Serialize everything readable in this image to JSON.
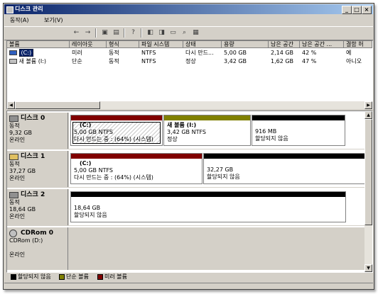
{
  "window": {
    "title": "디스크 관리",
    "controls": {
      "minimize": "_",
      "restore": "□",
      "close": "×"
    }
  },
  "menu": [
    {
      "label": "동작(A)"
    },
    {
      "label": "보기(V)"
    }
  ],
  "toolbar": {
    "icons": [
      "back-icon",
      "forward-icon",
      "up-folder-icon",
      "properties-icon",
      "help-icon",
      "disk-action-icon-1",
      "disk-action-icon-2",
      "folder-open-icon",
      "search-icon",
      "settings-icon"
    ]
  },
  "volume_list": {
    "columns": [
      "볼륨",
      "레이아웃",
      "형식",
      "파일 시스템",
      "상태",
      "용량",
      "남은 공간",
      "남은 공간 ...",
      "결함 허"
    ],
    "rows": [
      {
        "volume": "(C:)",
        "layout": "미러",
        "type": "동적",
        "fs": "NTFS",
        "status": "다시 만드...",
        "capacity": "5,00 GB",
        "free": "2,14 GB",
        "free_pct": "42 %",
        "fault": "예"
      },
      {
        "volume": "새 볼륨 (I:)",
        "layout": "단순",
        "type": "동적",
        "fs": "NTFS",
        "status": "정상",
        "capacity": "3,42 GB",
        "free": "1,62 GB",
        "free_pct": "47 %",
        "fault": "아니오"
      }
    ]
  },
  "disks": [
    {
      "name": "디스크 0",
      "type": "동적",
      "size": "9,32 GB",
      "status": "온라인",
      "partitions": [
        {
          "name": "(C:)",
          "line1": "5,00 GB NTFS",
          "line2": "다시 만드는 중 : (64%) (시스템)",
          "kind": "mirror"
        },
        {
          "name": "새 볼륨  (I:)",
          "line1": "3,42 GB NTFS",
          "line2": "정상",
          "kind": "simple"
        },
        {
          "name": "",
          "line1": "916 MB",
          "line2": "할당되지 않음",
          "kind": "unallocated"
        }
      ]
    },
    {
      "name": "디스크 1",
      "type": "동적",
      "size": "37,27 GB",
      "status": "온라인",
      "partitions": [
        {
          "name": "(C:)",
          "line1": "5,00 GB NTFS",
          "line2": "다시 만드는 중 : (64%) (시스템)",
          "kind": "mirror"
        },
        {
          "name": "",
          "line1": "32,27 GB",
          "line2": "할당되지 않음",
          "kind": "unallocated"
        }
      ]
    },
    {
      "name": "디스크 2",
      "type": "동적",
      "size": "18,64 GB",
      "status": "온라인",
      "partitions": [
        {
          "name": "",
          "line1": "18,64 GB",
          "line2": "할당되지 않음",
          "kind": "unallocated"
        }
      ]
    },
    {
      "name": "CDRom 0",
      "type": "CDRom (D:)",
      "size": "",
      "status": "온라인",
      "partitions": []
    }
  ],
  "legend": [
    {
      "label": "할당되지 않음",
      "color": "#000000"
    },
    {
      "label": "단순 볼륨",
      "color": "#808000"
    },
    {
      "label": "미러 볼륨",
      "color": "#800000"
    }
  ],
  "colors": {
    "mirror": "#800000",
    "simple": "#808000",
    "unallocated": "#000000"
  }
}
